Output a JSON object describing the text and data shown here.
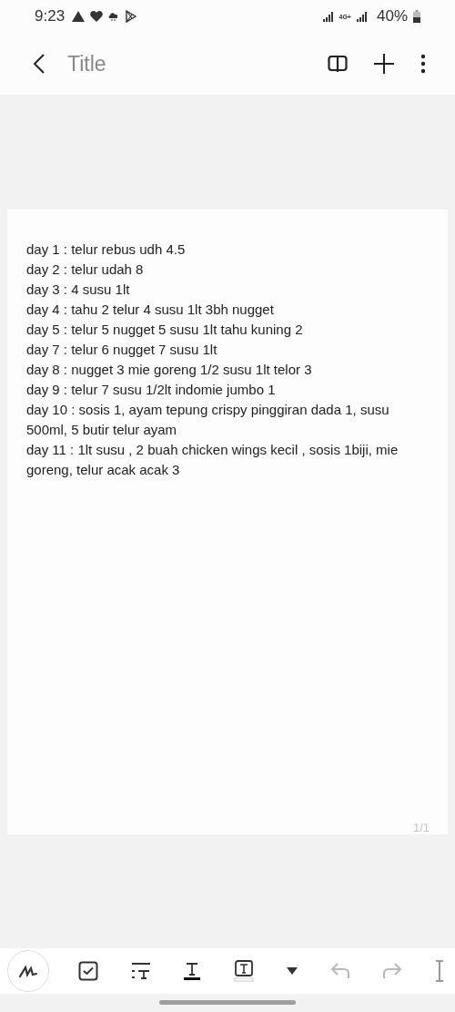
{
  "status_bar": {
    "time": "9:23",
    "network": "4G+",
    "battery": "40%"
  },
  "app_bar": {
    "title": "Title"
  },
  "note": {
    "lines": [
      "day 1 : telur rebus udh 4.5",
      "day 2 : telur udah 8",
      "day 3 : 4 susu 1lt",
      "day 4 : tahu 2 telur 4 susu 1lt 3bh nugget",
      "day 5 : telur 5 nugget 5 susu 1lt tahu kuning 2",
      "day 7 : telur 6 nugget 7 susu 1lt",
      "day 8 : nugget 3 mie goreng 1/2 susu 1lt telor 3",
      "day 9 : telur 7 susu 1/2lt indomie jumbo 1",
      "day 10 : sosis 1, ayam tepung crispy pinggiran dada 1, susu 500ml, 5 butir telur ayam",
      "day 11 : 1lt susu , 2 buah chicken wings kecil , sosis 1biji, mie goreng, telur acak acak 3"
    ],
    "page_indicator": "1/1"
  },
  "toolbar": [
    {
      "kind": "pen",
      "disabled": false
    },
    {
      "kind": "checkbox",
      "disabled": false
    },
    {
      "kind": "text-style",
      "disabled": false
    },
    {
      "kind": "text-color",
      "disabled": false
    },
    {
      "kind": "highlight",
      "disabled": false
    },
    {
      "kind": "dropdown",
      "disabled": false
    },
    {
      "kind": "undo",
      "disabled": true
    },
    {
      "kind": "redo",
      "disabled": true
    },
    {
      "kind": "resize",
      "disabled": false
    }
  ]
}
